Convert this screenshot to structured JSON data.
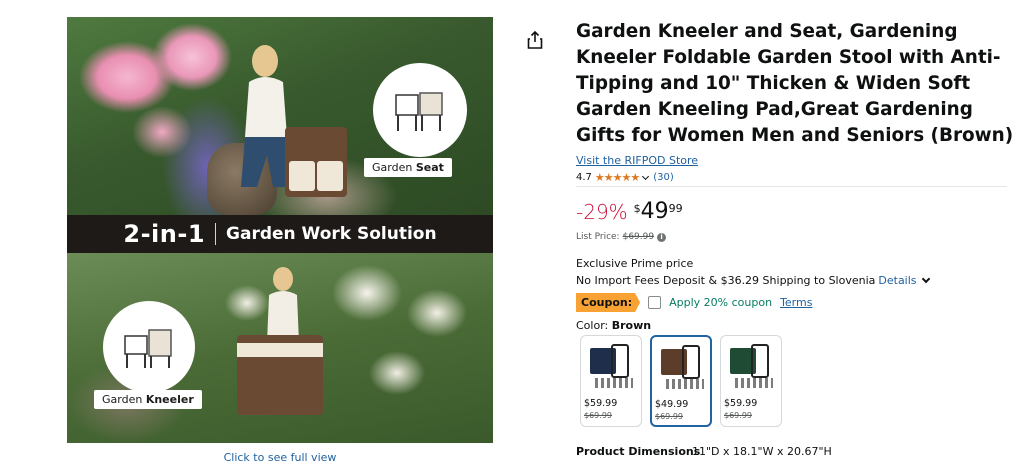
{
  "gallery": {
    "banner_big": "2-in-1",
    "banner_small": "Garden Work Solution",
    "tag_top_pre": "Garden ",
    "tag_top_bold": "Seat",
    "tag_bot_pre": "Garden ",
    "tag_bot_bold": "Kneeler",
    "see_full": "Click to see full view"
  },
  "share": {
    "icon": "share-icon"
  },
  "product": {
    "title": "Garden Kneeler and Seat, Gardening Kneeler Foldable Garden Stool with Anti-Tipping and 10\" Thicken & Widen Soft Garden Kneeling Pad,Great Gardening Gifts for Women Men and Seniors (Brown)",
    "store_link": "Visit the RIFPOD Store",
    "rating_value": "4.7",
    "stars": "★★★★★",
    "review_count": "(30)"
  },
  "pricing": {
    "discount": "-29%",
    "currency": "$",
    "whole": "49",
    "fraction": "99",
    "list_label": "List Price:",
    "list_price": "$69.99",
    "prime_text": "Exclusive Prime price",
    "fees_text": "No Import Fees Deposit & $36.29 Shipping to Slovenia",
    "details_link": "Details"
  },
  "coupon": {
    "badge": "Coupon:",
    "text": "Apply 20% coupon",
    "terms": "Terms"
  },
  "color": {
    "label": "Color:",
    "selected": "Brown",
    "options": [
      {
        "name": "navy",
        "color": "#1f2e4a",
        "price": "$59.99",
        "list": "$69.99"
      },
      {
        "name": "brown",
        "color": "#5b3d2a",
        "price": "$49.99",
        "list": "$69.99"
      },
      {
        "name": "green",
        "color": "#1f4a33",
        "price": "$59.99",
        "list": "$69.99"
      }
    ]
  },
  "specs": {
    "key": "Product Dimensions",
    "value": "11\"D x 18.1\"W x 20.67\"H"
  }
}
